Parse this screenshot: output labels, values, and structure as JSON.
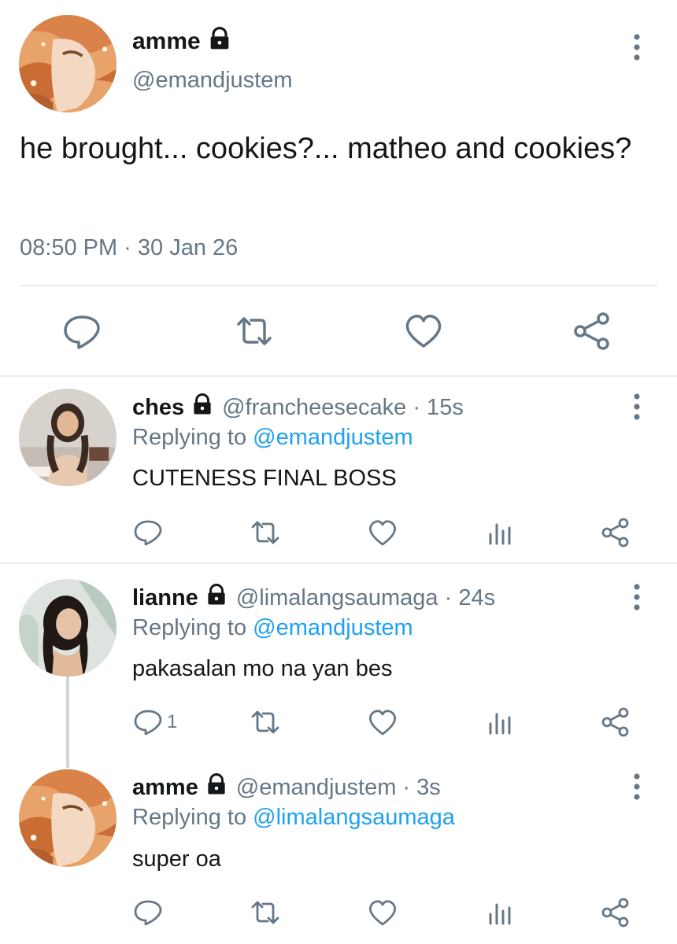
{
  "main": {
    "name": "amme",
    "handle": "@emandjustem",
    "text": "he brought... cookies?... matheo and cookies?",
    "timestamp": "08:50 PM · 30 Jan 26"
  },
  "replies": [
    {
      "name": "ches",
      "handle": "@francheesecake · 15s",
      "replying_prefix": "Replying to ",
      "replying_to": "@emandjustem",
      "text": "CUTENESS FINAL BOSS",
      "reply_count": ""
    },
    {
      "name": "lianne",
      "handle": "@limalangsaumaga · 24s",
      "replying_prefix": "Replying to ",
      "replying_to": "@emandjustem",
      "text": "pakasalan mo na yan bes",
      "reply_count": "1"
    },
    {
      "name": "amme",
      "handle": "@emandjustem · 3s",
      "replying_prefix": "Replying to ",
      "replying_to": "@limalangsaumaga",
      "text": "super oa",
      "reply_count": ""
    }
  ],
  "icons": {
    "lock": "lock-icon",
    "more": "more-vertical-icon",
    "reply": "reply-icon",
    "retweet": "retweet-icon",
    "like": "heart-icon",
    "analytics": "analytics-icon",
    "share": "share-icon"
  },
  "colors": {
    "text": "#14171a",
    "secondary": "#657786",
    "link": "#1da1f2",
    "divider": "#e6ecf0"
  }
}
